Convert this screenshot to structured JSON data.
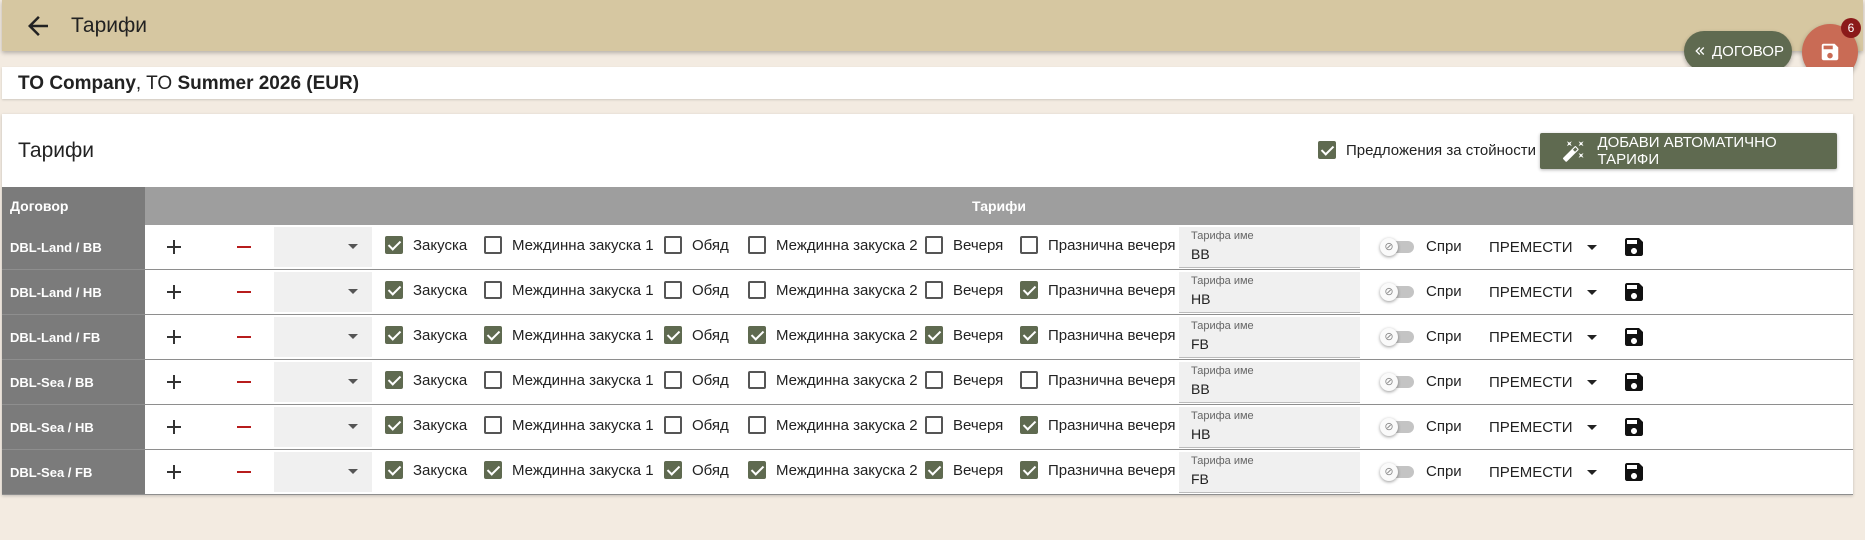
{
  "header": {
    "title": "Тарифи"
  },
  "fab": {
    "contract_label": "ДОГОВОР",
    "badge_count": "6"
  },
  "contract": {
    "company": "TO Company",
    "separator": ",",
    "prefix": "TO",
    "season": "Summer 2026 (EUR)"
  },
  "card": {
    "title": "Тарифи",
    "suggestions_label": "Предложения за стойности",
    "suggestions_checked": true,
    "auto_button_label": "ДОБАВИ АВТОМАТИЧНО ТАРИФИ"
  },
  "table": {
    "col_contract": "Договор",
    "col_rates": "Тарифи",
    "meal_labels": [
      "Закуска",
      "Междинна закуска 1",
      "Обяд",
      "Междинна закуска 2",
      "Вечеря",
      "Празнична вечеря"
    ],
    "name_field_label": "Тарифа име",
    "stop_label": "Спри",
    "move_label": "ПРЕМЕСТИ",
    "rows": [
      {
        "contract": "DBL-Land / BB",
        "name": "BB",
        "meals": [
          true,
          false,
          false,
          false,
          false,
          false
        ]
      },
      {
        "contract": "DBL-Land / HB",
        "name": "HB",
        "meals": [
          true,
          false,
          false,
          false,
          false,
          true
        ]
      },
      {
        "contract": "DBL-Land / FB",
        "name": "FB",
        "meals": [
          true,
          true,
          true,
          true,
          true,
          true
        ]
      },
      {
        "contract": "DBL-Sea / BB",
        "name": "BB",
        "meals": [
          true,
          false,
          false,
          false,
          false,
          false
        ]
      },
      {
        "contract": "DBL-Sea / HB",
        "name": "HB",
        "meals": [
          true,
          false,
          false,
          false,
          false,
          true
        ]
      },
      {
        "contract": "DBL-Sea / FB",
        "name": "FB",
        "meals": [
          true,
          true,
          true,
          true,
          true,
          true
        ]
      }
    ]
  },
  "colors": {
    "primary": "#5f6a50",
    "header_bg": "#d6c7a1",
    "fab_save": "#c96b55",
    "badge": "#8b1a1a",
    "minus": "#b71c1c"
  }
}
